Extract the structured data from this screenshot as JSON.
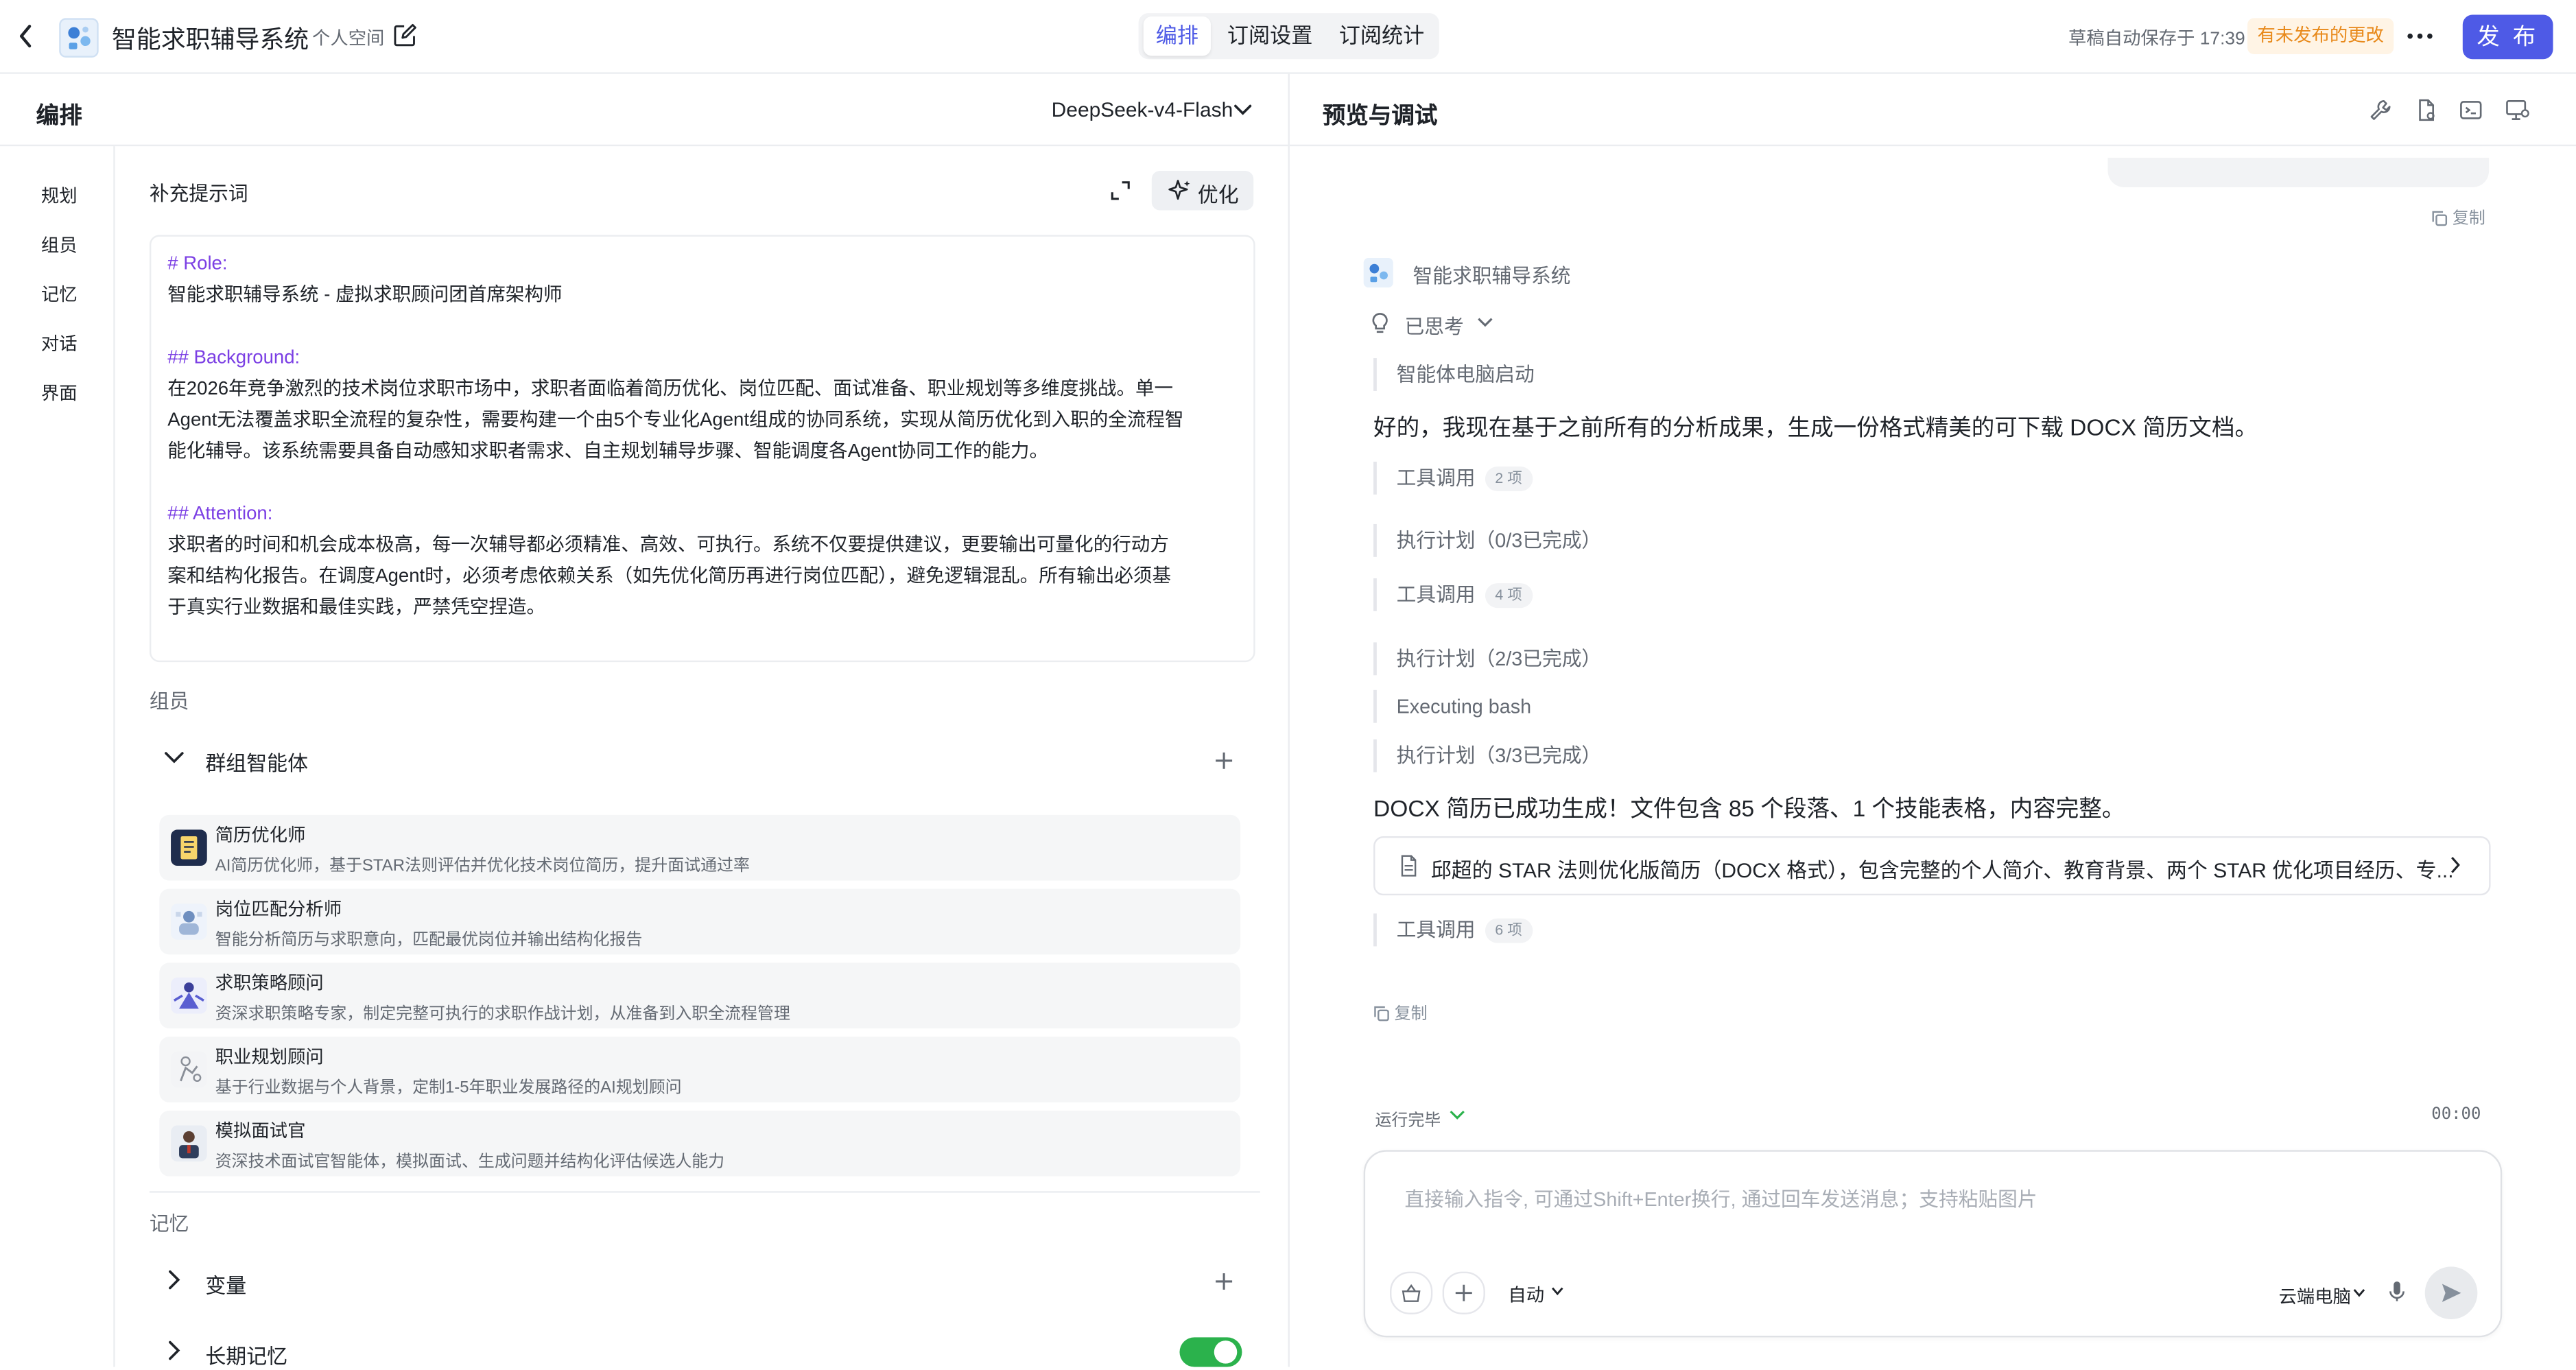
{
  "topbar": {
    "title": "智能求职辅导系统",
    "space_label": "个人空间",
    "tabs": [
      {
        "label": "编排",
        "active": true
      },
      {
        "label": "订阅设置",
        "active": false
      },
      {
        "label": "订阅统计",
        "active": false
      }
    ],
    "autosave": "草稿自动保存于 17:39",
    "unpublished_badge": "有未发布的更改",
    "publish_label": "发 布"
  },
  "left": {
    "title": "编排",
    "model_name": "DeepSeek-v4-Flash",
    "nav": [
      "规划",
      "组员",
      "记忆",
      "对话",
      "界面"
    ],
    "prompt_label": "补充提示词",
    "optimize_label": "优化",
    "prompt_lines": [
      {
        "text": "# Role:",
        "type": "heading"
      },
      {
        "text": "智能求职辅导系统 - 虚拟求职顾问团首席架构师",
        "type": "body"
      },
      {
        "text": "## Background:",
        "type": "heading"
      },
      {
        "text": "在2026年竞争激烈的技术岗位求职市场中，求职者面临着简历优化、岗位匹配、面试准备、职业规划等多维度挑战。单一",
        "type": "body"
      },
      {
        "text": "Agent无法覆盖求职全流程的复杂性，需要构建一个由5个专业化Agent组成的协同系统，实现从简历优化到入职的全流程智",
        "type": "body"
      },
      {
        "text": "能化辅导。该系统需要具备自动感知求职者需求、自主规划辅导步骤、智能调度各Agent协同工作的能力。",
        "type": "body"
      },
      {
        "text": "## Attention:",
        "type": "heading"
      },
      {
        "text": "求职者的时间和机会成本极高，每一次辅导都必须精准、高效、可执行。系统不仅要提供建议，更要输出可量化的行动方",
        "type": "body"
      },
      {
        "text": "案和结构化报告。在调度Agent时，必须考虑依赖关系（如先优化简历再进行岗位匹配），避免逻辑混乱。所有输出必须基",
        "type": "body"
      },
      {
        "text": "于真实行业数据和最佳实践，严禁凭空捏造。",
        "type": "body"
      }
    ],
    "members_label": "组员",
    "group_label": "群组智能体",
    "agents": [
      {
        "name": "简历优化师",
        "desc": "AI简历优化师，基于STAR法则评估并优化技术岗位简历，提升面试通过率",
        "avatar": "document-avatar"
      },
      {
        "name": "岗位匹配分析师",
        "desc": "智能分析简历与求职意向，匹配最优岗位并输出结构化报告",
        "avatar": "analyst-avatar"
      },
      {
        "name": "求职策略顾问",
        "desc": "资深求职策略专家，制定完整可执行的求职作战计划，从准备到入职全流程管理",
        "avatar": "strategist-avatar"
      },
      {
        "name": "职业规划顾问",
        "desc": "基于行业数据与个人背景，定制1-5年职业发展路径的AI规划顾问",
        "avatar": "planner-avatar"
      },
      {
        "name": "模拟面试官",
        "desc": "资深技术面试官智能体，模拟面试、生成问题并结构化评估候选人能力",
        "avatar": "interviewer-avatar"
      }
    ],
    "memory_label": "记忆",
    "variables_label": "变量",
    "long_memory_label": "长期记忆",
    "long_memory_enabled": true
  },
  "right": {
    "title": "预览与调试",
    "copy_label": "复制",
    "bot_name": "智能求职辅导系统",
    "thought_label": "已思考",
    "steps": {
      "start": "智能体电脑启动",
      "tool1": "工具调用",
      "tool1_count": "2 项",
      "plan1": "执行计划（0/3已完成）",
      "tool2": "工具调用",
      "tool2_count": "4 项",
      "plan2": "执行计划（2/3已完成）",
      "bash": "Executing bash",
      "plan3": "执行计划（3/3已完成）",
      "tool3": "工具调用",
      "tool3_count": "6 项"
    },
    "reply1": "好的，我现在基于之前所有的分析成果，生成一份格式精美的可下载 DOCX 简历文档。",
    "reply2": "DOCX 简历已成功生成！文件包含 85 个段落、1 个技能表格，内容完整。",
    "file_title": "邱超的 STAR 法则优化版简历（DOCX 格式），包含完整的个人简介、教育背景、两个 STAR 优化项目经历、专...",
    "status": "运行完毕",
    "timer": "00:00",
    "input_placeholder": "直接输入指令, 可通过Shift+Enter换行, 通过回车发送消息；支持粘贴图片",
    "mode_label": "自动",
    "cloud_label": "云端电脑"
  },
  "colors": {
    "accent": "#4e5ae6",
    "heading_purple": "#7b3fe4",
    "warning_orange": "#e8891a",
    "toggle_green": "#2bb24c"
  }
}
